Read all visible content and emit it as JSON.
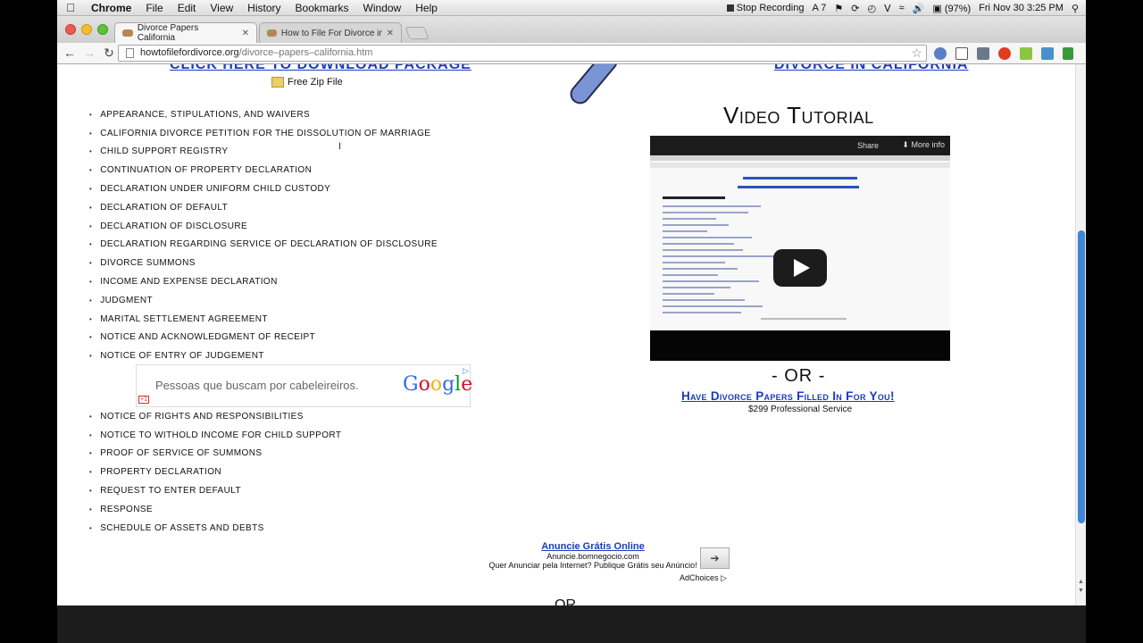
{
  "menubar": {
    "app": "Chrome",
    "menus": [
      "File",
      "Edit",
      "View",
      "History",
      "Bookmarks",
      "Window",
      "Help"
    ],
    "stop_recording": "Stop Recording",
    "adobe": "7",
    "battery": "(97%)",
    "datetime": "Fri Nov 30  3:25 PM"
  },
  "tabs": [
    {
      "title": "Divorce Papers California"
    },
    {
      "title": "How to File For Divorce in A"
    }
  ],
  "toolbar": {
    "url_host": "howtofilefordivorce.org",
    "url_path": "/divorce–papers–california.htm"
  },
  "page": {
    "zip_label": "Free Zip File",
    "forms_a": [
      "APPEARANCE, STIPULATIONS, AND WAIVERS",
      "CALIFORNIA DIVORCE PETITION FOR THE DISSOLUTION OF MARRIAGE",
      "CHILD SUPPORT REGISTRY",
      "CONTINUATION OF PROPERTY DECLARATION",
      "DECLARATION UNDER UNIFORM CHILD CUSTODY",
      "DECLARATION OF DEFAULT",
      "DECLARATION OF DISCLOSURE",
      "DECLARATION REGARDING SERVICE OF DECLARATION OF DISCLOSURE",
      "DIVORCE SUMMONS",
      "INCOME AND EXPENSE DECLARATION",
      "JUDGMENT",
      "MARITAL SETTLEMENT AGREEMENT",
      "NOTICE AND ACKNOWLEDGMENT OF RECEIPT",
      "NOTICE OF ENTRY OF JUDGEMENT"
    ],
    "forms_b": [
      "NOTICE OF RIGHTS AND RESPONSIBILITIES",
      "NOTICE TO WITHOLD INCOME FOR CHILD SUPPORT",
      "PROOF OF SERVICE OF SUMMONS",
      "PROPERTY DECLARATION",
      "REQUEST TO ENTER DEFAULT",
      "RESPONSE",
      "SCHEDULE OF ASSETS AND DEBTS"
    ],
    "google_ad": {
      "text": "Pessoas que buscam por cabeleireiros.",
      "logo": "Google",
      "plus": "+1"
    },
    "video_title": "Video Tutorial",
    "video": {
      "share": "Share",
      "more_info": "More info"
    },
    "or_text": "- OR -",
    "have_papers_link": "Have Divorce Papers Filled In For You!",
    "price": "$299 Professional Service",
    "bottom_ad": {
      "title": "Anuncie Grátis Online",
      "domain": "Anuncie.bomnegocio.com",
      "desc": "Quer Anunciar pela Internet? Publique Grátis seu Anúncio!",
      "adchoices": "AdChoices"
    },
    "or_bottom": "OR"
  },
  "colors": {
    "link": "#1a3bc1",
    "scrollbar_thumb": "#3f86d6",
    "background": "#ffffff"
  }
}
